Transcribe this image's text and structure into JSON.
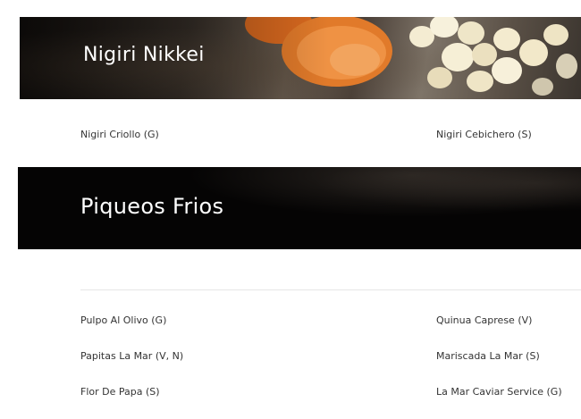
{
  "sections": [
    {
      "title": "Nigiri Nikkei",
      "items": [
        "Nigiri Criollo (G)",
        "Nigiri Cebichero (S)"
      ]
    },
    {
      "title": "Piqueos Frios",
      "items": [
        "Pulpo Al Olivo (G)",
        "Quinua Caprese (V)",
        "Papitas La Mar (V, N)",
        "Mariscada La Mar (S)",
        "Flor De Papa (S)",
        "La Mar Caviar Service (G)"
      ]
    }
  ]
}
